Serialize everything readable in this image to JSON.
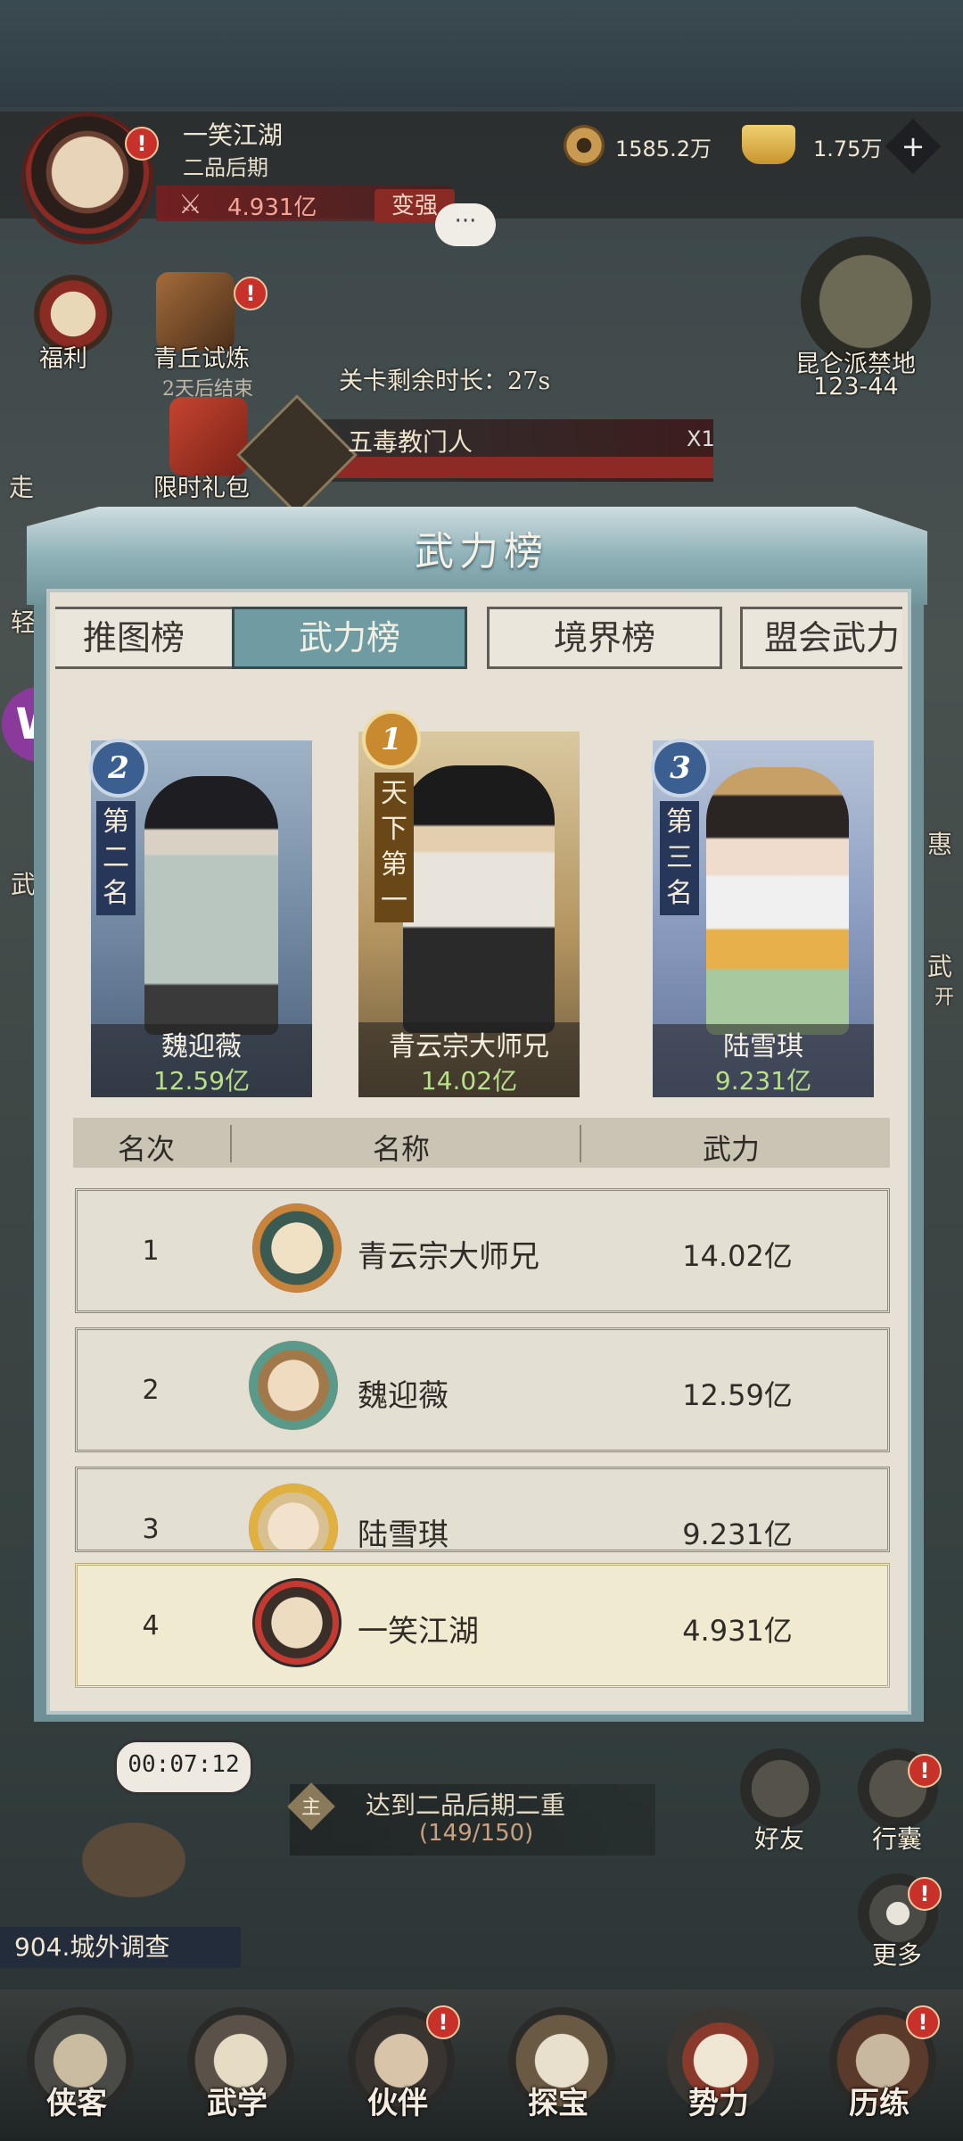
{
  "hud": {
    "player_name": "一笑江湖",
    "player_rank": "二品后期",
    "power": "4.931亿",
    "change_label": "变强",
    "coins": "1585.2万",
    "ingots": "1.75万",
    "plus": "+",
    "chat": "···"
  },
  "left_menu": {
    "welfare": "福利",
    "trial": "青丘试炼",
    "trial_sub": "2天后结束",
    "gift": "限时礼包",
    "partial_left": "走",
    "partial_light": "轻",
    "partial_wu": "武"
  },
  "right_menu": {
    "kunlun": "昆仑派禁地",
    "kunlun_stage": "123-44",
    "partial_hui": "惠",
    "partial_wu": "武",
    "partial_kai": "开"
  },
  "battle": {
    "timer_text": "关卡剩余时长：27s",
    "boss_name": "五毒教门人",
    "boss_multiplier": "X1"
  },
  "modal": {
    "title": "武力榜",
    "tabs": [
      "推图榜",
      "武力榜",
      "境界榜",
      "盟会武力"
    ],
    "active_tab": 1,
    "podium": [
      {
        "rank": "2",
        "title": "第二名",
        "name": "魏迎薇",
        "power": "12.59亿"
      },
      {
        "rank": "1",
        "title": "天下第一",
        "name": "青云宗大师兄",
        "power": "14.02亿"
      },
      {
        "rank": "3",
        "title": "第三名",
        "name": "陆雪琪",
        "power": "9.231亿"
      }
    ],
    "columns": {
      "rank": "名次",
      "name": "名称",
      "power": "武力"
    },
    "rows": [
      {
        "rank": "1",
        "name": "青云宗大师兄",
        "power": "14.02亿"
      },
      {
        "rank": "2",
        "name": "魏迎薇",
        "power": "12.59亿"
      },
      {
        "rank": "3",
        "name": "陆雪琪",
        "power": "9.231亿"
      }
    ],
    "my_row": {
      "rank": "4",
      "name": "一笑江湖",
      "power": "4.931亿"
    }
  },
  "bottom": {
    "timer": "00:07:12",
    "quest_badge": "主",
    "quest": "达到二品后期二重",
    "quest_progress": "(149/150)",
    "investigate": "904.城外调查",
    "friends": "好友",
    "bag": "行囊",
    "more": "更多"
  },
  "nav": [
    "侠客",
    "武学",
    "伙伴",
    "探宝",
    "势力",
    "历练"
  ],
  "colors": {
    "accent_teal": "#6f9ca2",
    "badge_red": "#c8312a",
    "power_green": "#b8e08a"
  }
}
